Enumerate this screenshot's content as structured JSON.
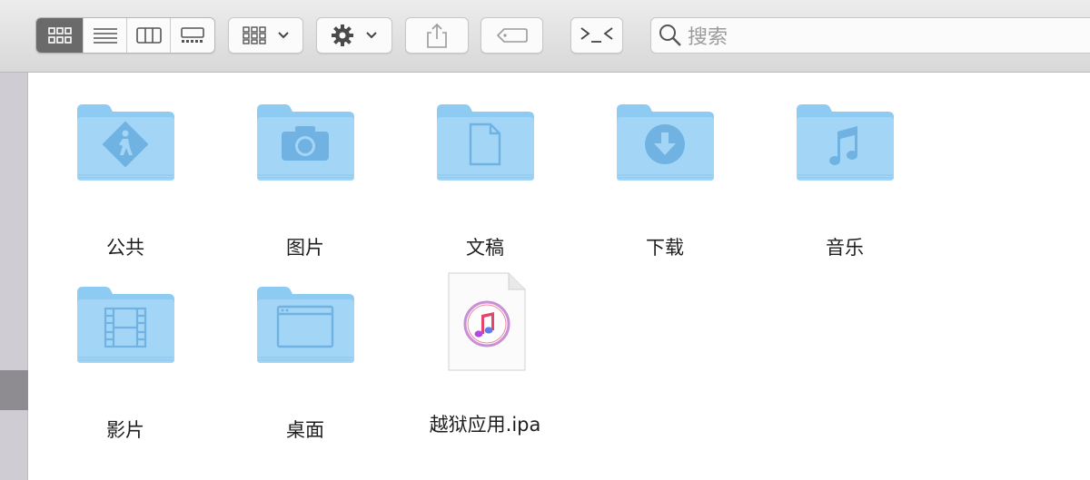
{
  "toolbar": {
    "view_modes": [
      "icon-view",
      "list-view",
      "column-view",
      "gallery-view"
    ],
    "active_view": "icon-view",
    "group_button_icon": "group-grid-icon",
    "action_button_icon": "gear-icon",
    "share_button_icon": "share-icon",
    "tag_button_icon": "tag-icon",
    "terminal_button_icon": "terminal-icon",
    "search": {
      "placeholder": "搜索"
    }
  },
  "colors": {
    "folder": "#8fcbf2",
    "folder_light": "#a8d8f8",
    "folder_glyph": "#6aafe0",
    "active_segment": "#6a6a6a"
  },
  "items": [
    {
      "name": "公共",
      "type": "folder",
      "glyph": "public-icon"
    },
    {
      "name": "图片",
      "type": "folder",
      "glyph": "camera-icon"
    },
    {
      "name": "文稿",
      "type": "folder",
      "glyph": "document-icon"
    },
    {
      "name": "下载",
      "type": "folder",
      "glyph": "download-icon"
    },
    {
      "name": "音乐",
      "type": "folder",
      "glyph": "music-note-icon"
    },
    {
      "name": "影片",
      "type": "folder",
      "glyph": "film-icon"
    },
    {
      "name": "桌面",
      "type": "folder",
      "glyph": "desktop-window-icon"
    },
    {
      "name": "越狱应用.ipa",
      "type": "file",
      "glyph": "itunes-icon"
    }
  ]
}
